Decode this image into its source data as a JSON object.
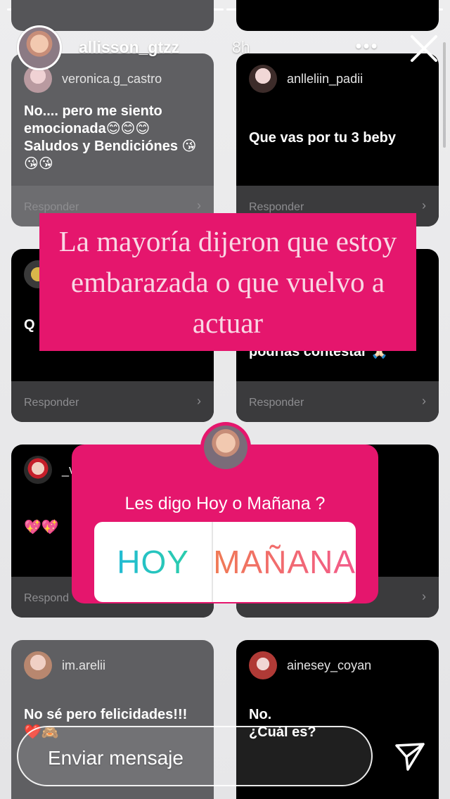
{
  "header": {
    "username": "allisson_gtzz",
    "time": "8h",
    "more": "•••",
    "close_icon": "close-icon"
  },
  "cards": [
    {
      "username": "veronica.g_castro",
      "message": "No.... pero me siento emocionada😊😊😊 Saludos y Bendiciónes 😘😘😘",
      "reply": "Responder"
    },
    {
      "username": "anlleliin_padii",
      "message": "Que vas por tu 3 beby",
      "reply": "Responder"
    },
    {
      "username": "",
      "message": "Q",
      "reply": "Responder"
    },
    {
      "username": "",
      "message": "podrías contestar 🙏🏻",
      "reply": "Responder"
    },
    {
      "username": "_v",
      "message": "💖💖",
      "reply": "Respond"
    },
    {
      "username": "",
      "message": "",
      "reply": ""
    },
    {
      "username": "im.arelii",
      "message": "No sé pero felicidades!!! ❤️🙈",
      "reply": "Responder"
    },
    {
      "username": "ainesey_coyan",
      "message": "No.\n¿Cuál es?",
      "reply": "Responder"
    }
  ],
  "banner": {
    "text": "La mayoría dijeron que estoy embarazada o que vuelvo a actuar"
  },
  "poll": {
    "question": "Les digo Hoy o Mañana ?",
    "options": [
      "HOY",
      "MAÑANA"
    ]
  },
  "message_bar": {
    "placeholder": "Enviar mensaje"
  },
  "colors": {
    "pink": "#e5166d",
    "hoy_gradient": [
      "#1fb5e0",
      "#2ed39f"
    ],
    "manana_gradient": [
      "#f07b55",
      "#f25a8a"
    ]
  }
}
